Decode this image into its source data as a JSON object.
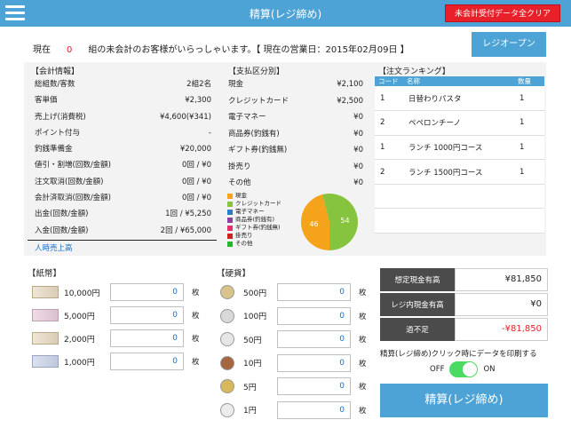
{
  "header": {
    "title": "精算(レジ締め)",
    "clear_label": "未会計受付データ全クリア"
  },
  "status": {
    "label": "現在",
    "count": "0",
    "message": "組の未会計のお客様がいらっしゃいます。【 現在の営業日：2015年02月09日 】",
    "register_open_label": "レジオープン"
  },
  "account": {
    "title": "【会計情報】",
    "rows": [
      {
        "k": "総組数/客数",
        "v": "2組2名"
      },
      {
        "k": "客単価",
        "v": "¥2,300"
      },
      {
        "k": "売上げ(消費税)",
        "v": "¥4,600(¥341)"
      },
      {
        "k": "ポイント付与",
        "v": "-"
      },
      {
        "k": "釣銭準備金",
        "v": "¥20,000"
      },
      {
        "k": "値引・割増(回数/金額)",
        "v": "0回 / ¥0"
      },
      {
        "k": "注文取消(回数/金額)",
        "v": "0回 / ¥0"
      },
      {
        "k": "会計済取消(回数/金額)",
        "v": "0回 / ¥0"
      },
      {
        "k": "出金(回数/金額)",
        "v": "1回 / ¥5,250"
      },
      {
        "k": "入金(回数/金額)",
        "v": "2回 / ¥65,000"
      }
    ],
    "hourly_link": "人時売上高"
  },
  "payment": {
    "title": "【支払区分別】",
    "rows": [
      {
        "k": "現金",
        "v": "¥2,100"
      },
      {
        "k": "クレジットカード",
        "v": "¥2,500"
      },
      {
        "k": "電子マネー",
        "v": "¥0"
      },
      {
        "k": "商品券(釣銭有)",
        "v": "¥0"
      },
      {
        "k": "ギフト券(釣銭無)",
        "v": "¥0"
      },
      {
        "k": "掛売り",
        "v": "¥0"
      },
      {
        "k": "その他",
        "v": "¥0"
      }
    ],
    "legend": [
      {
        "label": "現金",
        "color": "#f5a31a"
      },
      {
        "label": "クレジットカード",
        "color": "#86c440"
      },
      {
        "label": "電子マネー",
        "color": "#2a7fc4"
      },
      {
        "label": "商品券(釣銭有)",
        "color": "#8c3fa0"
      },
      {
        "label": "ギフト券(釣銭無)",
        "color": "#e0306a"
      },
      {
        "label": "掛売り",
        "color": "#cc2222"
      },
      {
        "label": "その他",
        "color": "#22b82a"
      }
    ],
    "pie": {
      "cash_pct": 46,
      "credit_pct": 54,
      "cash_label": "46",
      "credit_label": "54"
    }
  },
  "ranking": {
    "title": "【注文ランキング】",
    "headers": [
      "コード",
      "名称",
      "数量"
    ],
    "rows": [
      {
        "code": "1",
        "name": "日替わりパスタ",
        "qty": "1"
      },
      {
        "code": "2",
        "name": "ペペロンチーノ",
        "qty": "1"
      },
      {
        "code": "1",
        "name": "ランチ 1000円コース",
        "qty": "1"
      },
      {
        "code": "2",
        "name": "ランチ 1500円コース",
        "qty": "1"
      }
    ]
  },
  "bills": {
    "title": "【紙幣】",
    "unit": "枚",
    "rows": [
      {
        "label": "10,000円",
        "value": "0"
      },
      {
        "label": "5,000円",
        "value": "0"
      },
      {
        "label": "2,000円",
        "value": "0"
      },
      {
        "label": "1,000円",
        "value": "0"
      }
    ]
  },
  "coins": {
    "title": "【硬貨】",
    "unit": "枚",
    "rows": [
      {
        "label": "500円",
        "value": "0"
      },
      {
        "label": "100円",
        "value": "0"
      },
      {
        "label": "50円",
        "value": "0"
      },
      {
        "label": "10円",
        "value": "0"
      },
      {
        "label": "5円",
        "value": "0"
      },
      {
        "label": "1円",
        "value": "0"
      }
    ]
  },
  "summary": {
    "expected_label": "想定現金有高",
    "expected_value": "¥81,850",
    "actual_label": "レジ内現金有高",
    "actual_value": "¥0",
    "diff_label": "過不足",
    "diff_value": "-¥81,850"
  },
  "print": {
    "label": "精算(レジ締め)クリック時にデータを印刷する",
    "off": "OFF",
    "on": "ON"
  },
  "settle_label": "精算(レジ締め)"
}
